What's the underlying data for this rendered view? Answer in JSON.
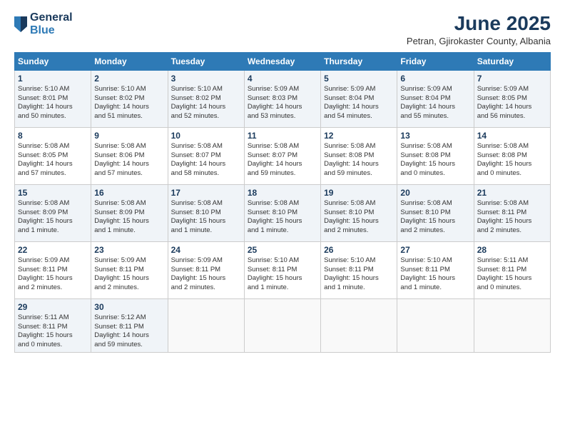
{
  "header": {
    "logo_general": "General",
    "logo_blue": "Blue",
    "month_year": "June 2025",
    "location": "Petran, Gjirokaster County, Albania"
  },
  "weekdays": [
    "Sunday",
    "Monday",
    "Tuesday",
    "Wednesday",
    "Thursday",
    "Friday",
    "Saturday"
  ],
  "weeks": [
    [
      {
        "day": "1",
        "info": "Sunrise: 5:10 AM\nSunset: 8:01 PM\nDaylight: 14 hours\nand 50 minutes."
      },
      {
        "day": "2",
        "info": "Sunrise: 5:10 AM\nSunset: 8:02 PM\nDaylight: 14 hours\nand 51 minutes."
      },
      {
        "day": "3",
        "info": "Sunrise: 5:10 AM\nSunset: 8:02 PM\nDaylight: 14 hours\nand 52 minutes."
      },
      {
        "day": "4",
        "info": "Sunrise: 5:09 AM\nSunset: 8:03 PM\nDaylight: 14 hours\nand 53 minutes."
      },
      {
        "day": "5",
        "info": "Sunrise: 5:09 AM\nSunset: 8:04 PM\nDaylight: 14 hours\nand 54 minutes."
      },
      {
        "day": "6",
        "info": "Sunrise: 5:09 AM\nSunset: 8:04 PM\nDaylight: 14 hours\nand 55 minutes."
      },
      {
        "day": "7",
        "info": "Sunrise: 5:09 AM\nSunset: 8:05 PM\nDaylight: 14 hours\nand 56 minutes."
      }
    ],
    [
      {
        "day": "8",
        "info": "Sunrise: 5:08 AM\nSunset: 8:05 PM\nDaylight: 14 hours\nand 57 minutes."
      },
      {
        "day": "9",
        "info": "Sunrise: 5:08 AM\nSunset: 8:06 PM\nDaylight: 14 hours\nand 57 minutes."
      },
      {
        "day": "10",
        "info": "Sunrise: 5:08 AM\nSunset: 8:07 PM\nDaylight: 14 hours\nand 58 minutes."
      },
      {
        "day": "11",
        "info": "Sunrise: 5:08 AM\nSunset: 8:07 PM\nDaylight: 14 hours\nand 59 minutes."
      },
      {
        "day": "12",
        "info": "Sunrise: 5:08 AM\nSunset: 8:08 PM\nDaylight: 14 hours\nand 59 minutes."
      },
      {
        "day": "13",
        "info": "Sunrise: 5:08 AM\nSunset: 8:08 PM\nDaylight: 15 hours\nand 0 minutes."
      },
      {
        "day": "14",
        "info": "Sunrise: 5:08 AM\nSunset: 8:08 PM\nDaylight: 15 hours\nand 0 minutes."
      }
    ],
    [
      {
        "day": "15",
        "info": "Sunrise: 5:08 AM\nSunset: 8:09 PM\nDaylight: 15 hours\nand 1 minute."
      },
      {
        "day": "16",
        "info": "Sunrise: 5:08 AM\nSunset: 8:09 PM\nDaylight: 15 hours\nand 1 minute."
      },
      {
        "day": "17",
        "info": "Sunrise: 5:08 AM\nSunset: 8:10 PM\nDaylight: 15 hours\nand 1 minute."
      },
      {
        "day": "18",
        "info": "Sunrise: 5:08 AM\nSunset: 8:10 PM\nDaylight: 15 hours\nand 1 minute."
      },
      {
        "day": "19",
        "info": "Sunrise: 5:08 AM\nSunset: 8:10 PM\nDaylight: 15 hours\nand 2 minutes."
      },
      {
        "day": "20",
        "info": "Sunrise: 5:08 AM\nSunset: 8:10 PM\nDaylight: 15 hours\nand 2 minutes."
      },
      {
        "day": "21",
        "info": "Sunrise: 5:08 AM\nSunset: 8:11 PM\nDaylight: 15 hours\nand 2 minutes."
      }
    ],
    [
      {
        "day": "22",
        "info": "Sunrise: 5:09 AM\nSunset: 8:11 PM\nDaylight: 15 hours\nand 2 minutes."
      },
      {
        "day": "23",
        "info": "Sunrise: 5:09 AM\nSunset: 8:11 PM\nDaylight: 15 hours\nand 2 minutes."
      },
      {
        "day": "24",
        "info": "Sunrise: 5:09 AM\nSunset: 8:11 PM\nDaylight: 15 hours\nand 2 minutes."
      },
      {
        "day": "25",
        "info": "Sunrise: 5:10 AM\nSunset: 8:11 PM\nDaylight: 15 hours\nand 1 minute."
      },
      {
        "day": "26",
        "info": "Sunrise: 5:10 AM\nSunset: 8:11 PM\nDaylight: 15 hours\nand 1 minute."
      },
      {
        "day": "27",
        "info": "Sunrise: 5:10 AM\nSunset: 8:11 PM\nDaylight: 15 hours\nand 1 minute."
      },
      {
        "day": "28",
        "info": "Sunrise: 5:11 AM\nSunset: 8:11 PM\nDaylight: 15 hours\nand 0 minutes."
      }
    ],
    [
      {
        "day": "29",
        "info": "Sunrise: 5:11 AM\nSunset: 8:11 PM\nDaylight: 15 hours\nand 0 minutes."
      },
      {
        "day": "30",
        "info": "Sunrise: 5:12 AM\nSunset: 8:11 PM\nDaylight: 14 hours\nand 59 minutes."
      },
      {
        "day": "",
        "info": ""
      },
      {
        "day": "",
        "info": ""
      },
      {
        "day": "",
        "info": ""
      },
      {
        "day": "",
        "info": ""
      },
      {
        "day": "",
        "info": ""
      }
    ]
  ]
}
